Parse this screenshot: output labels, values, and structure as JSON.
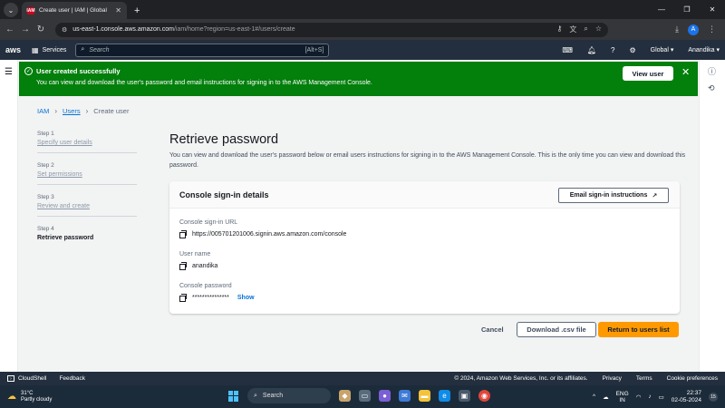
{
  "browser": {
    "tab_title": "Create user | IAM | Global",
    "favicon_text": "IAM",
    "url_host": "us-east-1.console.aws.amazon.com",
    "url_path": "/iam/home?region=us-east-1#/users/create",
    "profile_initial": "A"
  },
  "aws_nav": {
    "logo": "aws",
    "services_label": "Services",
    "search_placeholder": "Search",
    "search_shortcut": "[Alt+S]",
    "region": "Global ▾",
    "account": "Anandika ▾"
  },
  "flash": {
    "title": "User created successfully",
    "message": "You can view and download the user's password and email instructions for signing in to the AWS Management Console.",
    "button": "View user",
    "color": "#037f0c"
  },
  "breadcrumb": {
    "iam": "IAM",
    "users": "Users",
    "current": "Create user"
  },
  "steps": [
    {
      "num": "Step 1",
      "label": "Specify user details"
    },
    {
      "num": "Step 2",
      "label": "Set permissions"
    },
    {
      "num": "Step 3",
      "label": "Review and create"
    },
    {
      "num": "Step 4",
      "label": "Retrieve password"
    }
  ],
  "page": {
    "title": "Retrieve password",
    "description": "You can view and download the user's password below or email users instructions for signing in to the AWS Management Console. This is the only time you can view and download this password."
  },
  "card": {
    "title": "Console sign-in details",
    "email_button": "Email sign-in instructions",
    "url_label": "Console sign-in URL",
    "url_value": "https://005701201006.signin.aws.amazon.com/console",
    "username_label": "User name",
    "username_value": "anandika",
    "password_label": "Console password",
    "password_value": "***************",
    "show_label": "Show"
  },
  "actions": {
    "cancel": "Cancel",
    "download": "Download .csv file",
    "return": "Return to users list",
    "primary_color": "#ff9900"
  },
  "footer": {
    "cloudshell": "CloudShell",
    "feedback": "Feedback",
    "copyright": "© 2024, Amazon Web Services, Inc. or its affiliates.",
    "privacy": "Privacy",
    "terms": "Terms",
    "cookies": "Cookie preferences"
  },
  "taskbar": {
    "temperature": "31°C",
    "weather": "Partly cloudy",
    "search": "Search",
    "lang1": "ENG",
    "lang2": "IN",
    "time": "22:37",
    "date": "02-05-2024",
    "notifications": "15"
  }
}
